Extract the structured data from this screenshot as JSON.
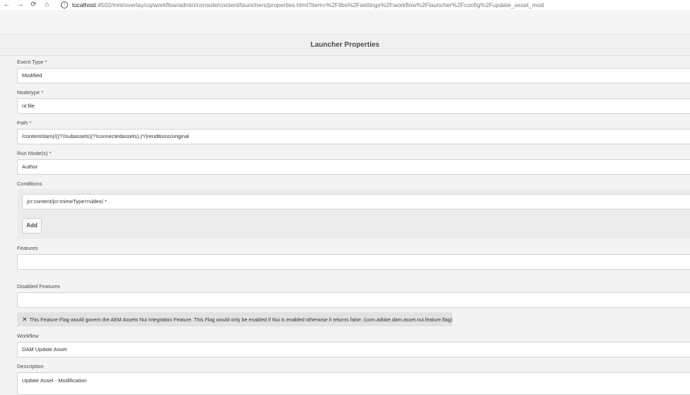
{
  "browser": {
    "back_icon": "←",
    "forward_icon": "→",
    "reload_icon": "⟳",
    "home_icon": "⌂",
    "info_icon": "i",
    "url_host": "localhost",
    "url_rest": ":4502/mnt/overlay/cq/workflow/admin/console/content/launchers/properties.html?item=%2Flibs%2Fsettings%2Fworkflow%2Flauncher%2Fconfig%2Fupdate_asset_mod"
  },
  "page": {
    "title": "Launcher Properties"
  },
  "form": {
    "event_type_label": "Event Type *",
    "event_type_value": "Modified",
    "nodetype_label": "Nodetype *",
    "nodetype_value": "nt:file",
    "path_label": "Path *",
    "path_value": "/content/dam(/((?!/subassets)(?!connectedassets).)*/)renditions/original",
    "run_modes_label": "Run Mode(s) *",
    "run_modes_value": "Author",
    "conditions_label": "Conditions",
    "condition_value": "jcr:content/jcr:mimeType!=video/.*",
    "add_label": "Add",
    "features_label": "Features",
    "features_value": "",
    "disabled_features_label": "Disabled Features",
    "disabled_features_value": "",
    "feature_flag_note": "This Feature Flag would govern the AEM Assets Nui integration Feature. This Flag would only be enabled if Nui is enabled otherwise it returns false. (com.adobe.dam.asset.nui.feature.flag)",
    "close_icon": "✕",
    "workflow_label": "Workflow",
    "workflow_value": "DAM Update Asset",
    "description_label": "Description",
    "description_value": "Update Asset - Modification"
  }
}
